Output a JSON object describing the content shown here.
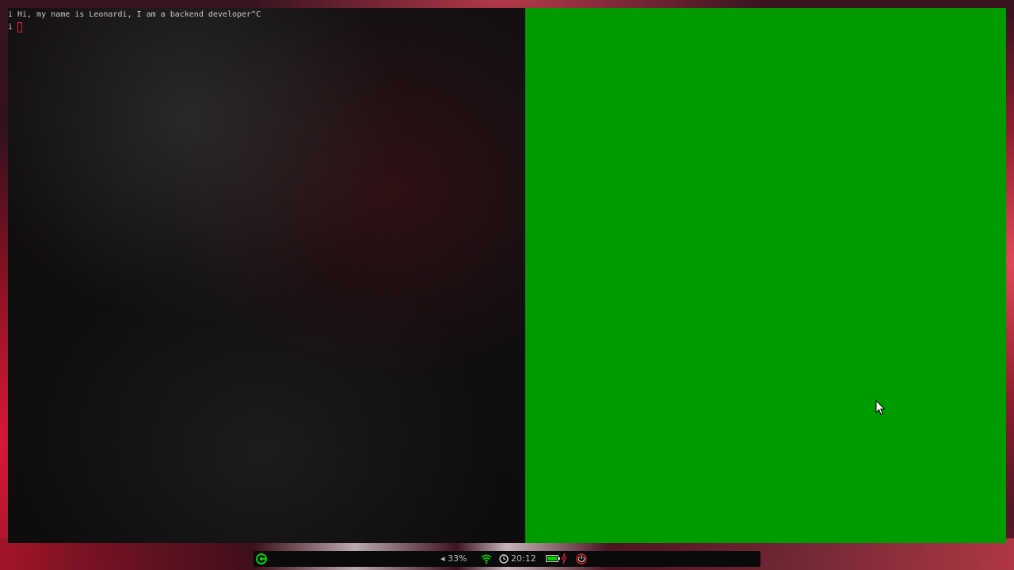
{
  "terminal": {
    "line1": "i Hi, my name is Leonardi, I am a backend developer^C",
    "line2_prompt": "i"
  },
  "statusbar": {
    "volume": "◂ 33%",
    "time": "20:12"
  },
  "colors": {
    "green_window": "#009b00",
    "accent": "#00d000",
    "cursor": "#e02030"
  },
  "icons": {
    "logo": "distro-logo-icon",
    "wifi": "wifi-icon",
    "clock": "clock-icon",
    "battery": "battery-icon",
    "charging": "charging-icon",
    "power": "power-icon",
    "pointer": "mouse-pointer-icon"
  }
}
